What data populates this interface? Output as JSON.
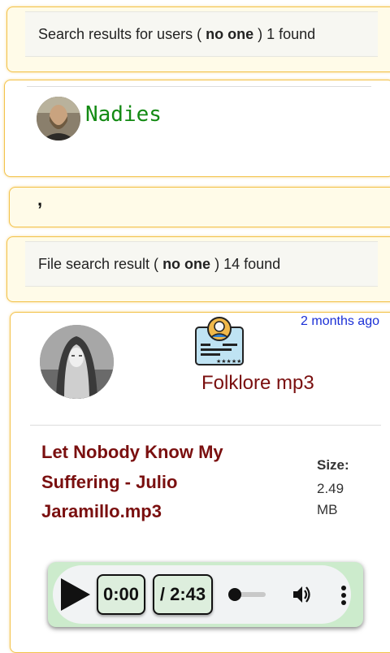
{
  "user_search": {
    "prefix": "Search results for users (",
    "query": "no one",
    "suffix": ") 1 found"
  },
  "user_result": {
    "name": "Nadies",
    "avatar_icon": "user-photo-icon"
  },
  "stray_text": ",",
  "file_search": {
    "prefix": "File search result (",
    "query": "no one",
    "suffix": ") 14 found"
  },
  "file_result": {
    "timestamp": "2 months ago",
    "category": "Folklore mp3",
    "category_icon": "profile-card-icon",
    "title": "Let Nobody Know My Suffering - Julio Jaramillo.mp3",
    "size_label": "Size:",
    "size_value": "2.49 MB"
  },
  "audio_player": {
    "current_time": "0:00",
    "duration": "/ 2:43",
    "progress": 0,
    "volume_icon": "volume-icon",
    "more_icon": "more-vertical-icon"
  },
  "colors": {
    "card_border": "#f3c24a",
    "card_bg": "#fffbe8",
    "user_name": "#138a13",
    "link_blue": "#1a2fd6",
    "file_title": "#7a0f0f",
    "player_bg": "#ccebcc"
  }
}
